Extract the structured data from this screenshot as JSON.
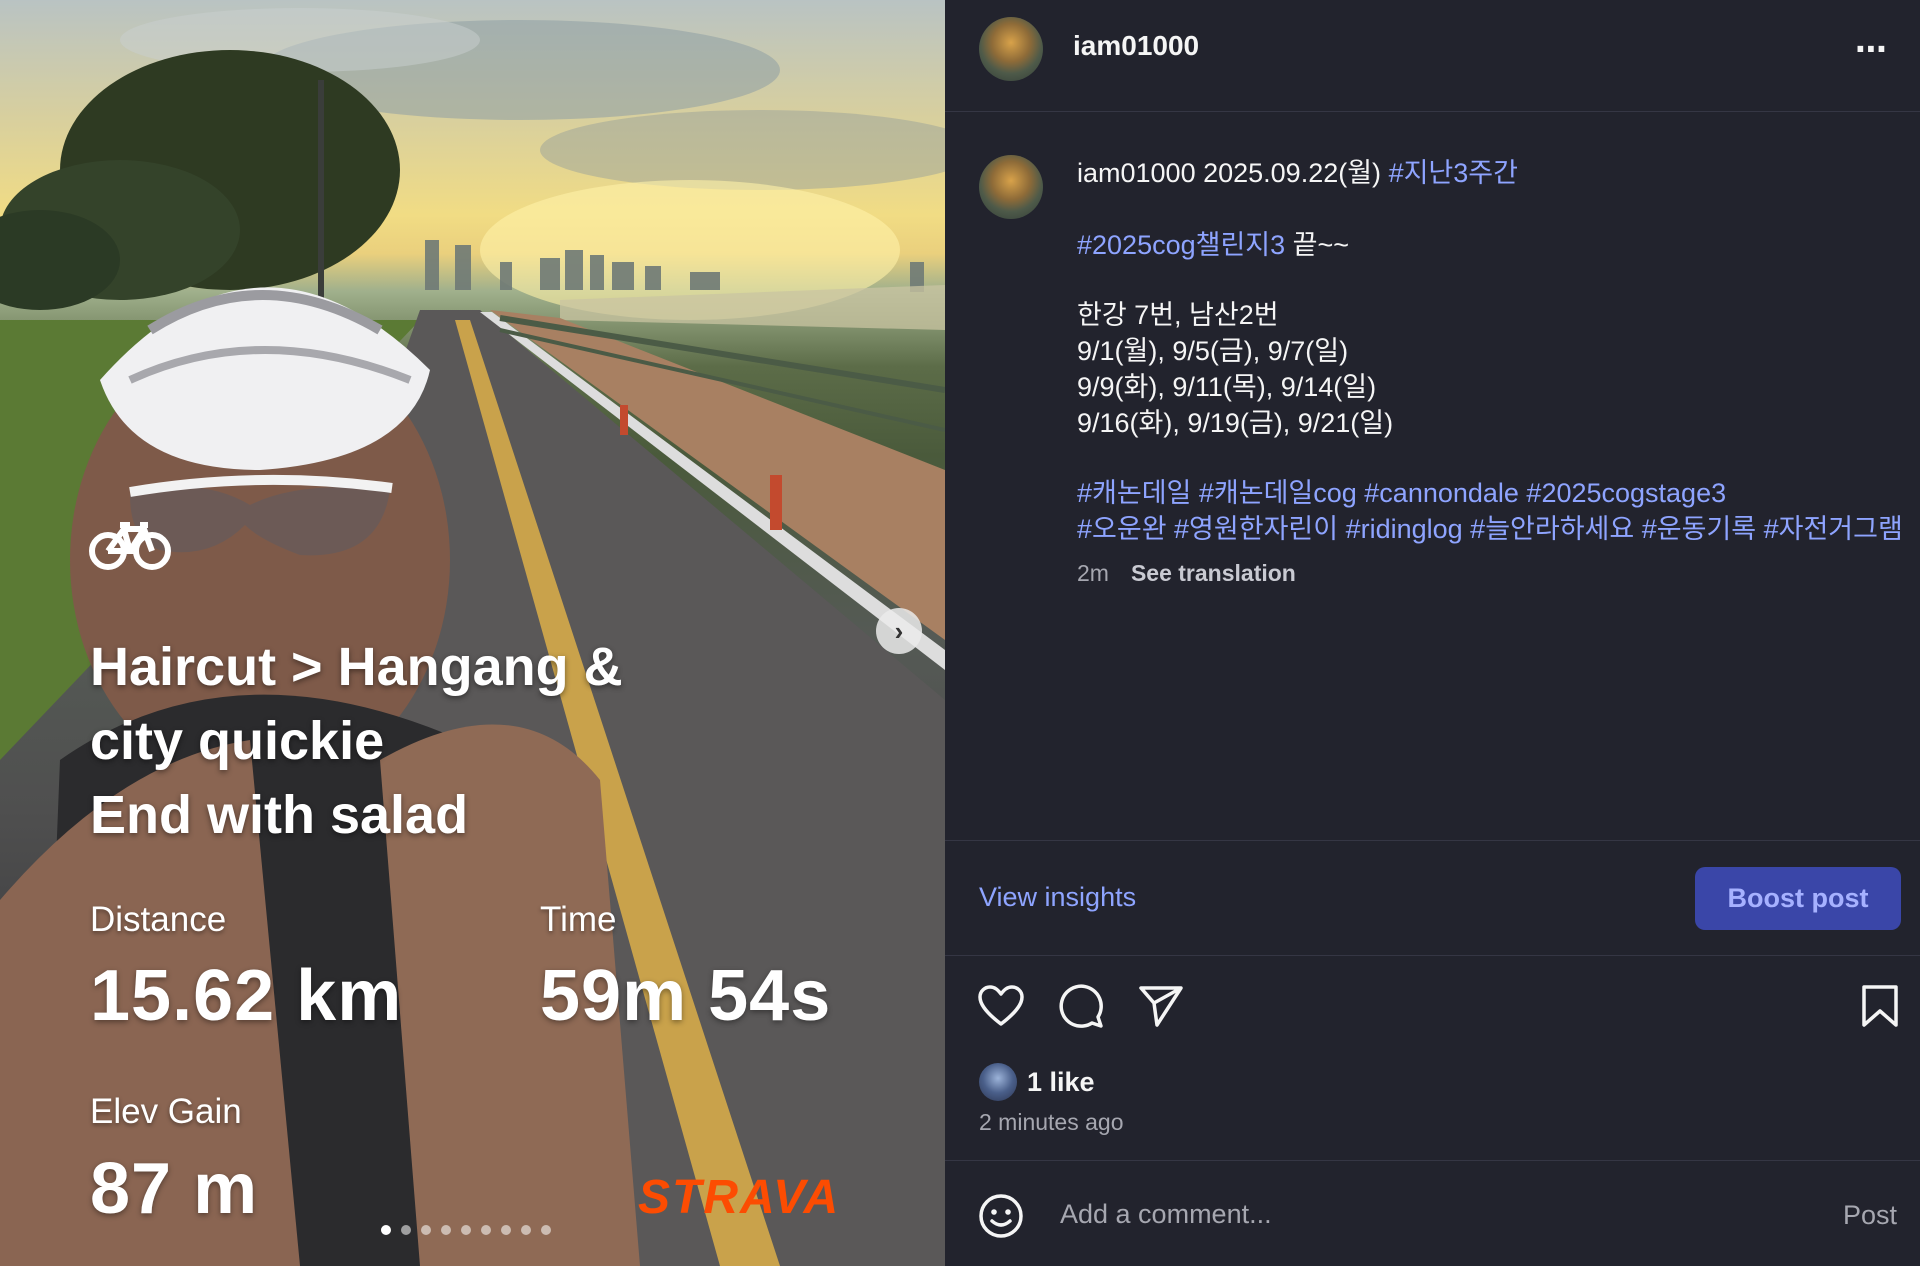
{
  "post": {
    "username": "iam01000",
    "more_icon": "⋯",
    "caption": {
      "author": "iam01000",
      "line1_text": " 2025.09.22(월) ",
      "line1_tag": "#지난3주간",
      "line2_tag": "#2025cog챌린지3",
      "line2_text": " 끝~~",
      "body_lines": [
        "한강 7번, 남산2번",
        "9/1(월), 9/5(금), 9/7(일)",
        "9/9(화), 9/11(목), 9/14(일)",
        "9/16(화), 9/19(금), 9/21(일)"
      ],
      "hashtags_line1": "#캐논데일 #캐논데일cog #cannondale #2025cogstage3",
      "hashtags_line2": "#오운완 #영원한자린이 #ridinglog #늘안라하세요 #운동기록 #자전거그램"
    },
    "time_ago": "2m",
    "see_translation": "See translation",
    "view_insights": "View insights",
    "boost_post": "Boost post",
    "likes": "1 like",
    "posted": "2 minutes ago",
    "comment_placeholder": "Add a comment...",
    "post_label": "Post"
  },
  "activity": {
    "title_lines": [
      "Haircut > Hangang &",
      "city quickie",
      "End with salad"
    ],
    "distance_label": "Distance",
    "distance_value": "15.62 km",
    "time_label": "Time",
    "time_value": "59m 54s",
    "elev_label": "Elev Gain",
    "elev_value": "87 m",
    "brand": "STRAVA"
  },
  "carousel": {
    "count": 9,
    "active_index": 0
  },
  "colors": {
    "accent": "#8ea4ff",
    "boost_bg": "#3a46a8",
    "strava": "#fc4c02",
    "panel_bg": "#22232d"
  }
}
